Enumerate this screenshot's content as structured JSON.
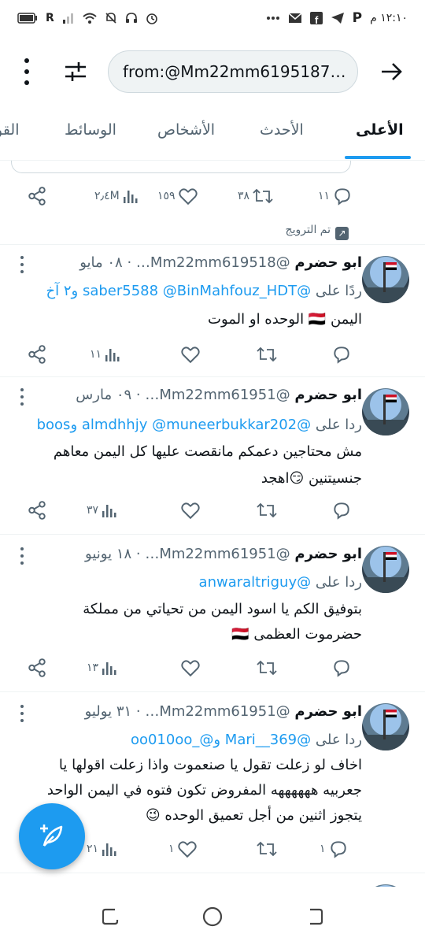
{
  "status_bar": {
    "time": "١٢:١٠ م",
    "carrier": "R",
    "icons": [
      "battery-icon",
      "signal-icon",
      "wifi-icon",
      "mute-icon",
      "headset-icon",
      "alarm-icon",
      "more-dots-icon",
      "mail-icon",
      "facebook-icon",
      "telegram-icon",
      "p-app-icon"
    ]
  },
  "search": {
    "query": "from:@Mm22mm6195187…"
  },
  "tabs": [
    {
      "label": "الأعلى",
      "active": true
    },
    {
      "label": "الأحدث",
      "active": false
    },
    {
      "label": "الأشخاص",
      "active": false
    },
    {
      "label": "الوسائط",
      "active": false
    },
    {
      "label": "القو",
      "active": false
    }
  ],
  "promoted_tweet": {
    "replies": "١١",
    "retweets": "٣٨",
    "likes": "١٥٩",
    "views": "٢٫٤M",
    "promoted_label": "تم الترويج"
  },
  "tweets": [
    {
      "name": "ابو حضرم",
      "handle": "@Mm22mm619518…",
      "date": "٠٨ مايو",
      "reply_prefix": "ردًا على",
      "reply_mentions": "@saber5588 @BinMahfouz_HDT",
      "reply_suffix": "و٢ آخ",
      "lines": [
        "اليمن 🇾🇪 الوحده او الموت"
      ],
      "replies": "",
      "retweets": "",
      "likes": "",
      "views": "١١"
    },
    {
      "name": "ابو حضرم",
      "handle": "@Mm22mm61951…",
      "date": "٠٩ مارس",
      "reply_prefix": "ردا على",
      "reply_mentions": "@almdhhjy @muneerbukkar202",
      "reply_suffix": "وboos",
      "lines": [
        "مش محتاجين دعمكم مانقصت عليها كل اليمن  معاهم",
        "جنسيتنين 😏اهجد"
      ],
      "replies": "",
      "retweets": "",
      "likes": "",
      "views": "٣٧"
    },
    {
      "name": "ابو حضرم",
      "handle": "@Mm22mm61951…",
      "date": "١٨ يونيو",
      "reply_prefix": "ردا على",
      "reply_mentions": "@anwaraltriguy",
      "reply_suffix": "",
      "lines": [
        "بتوفيق الكم يا اسود اليمن من تحياتي من مملكة",
        "حضرموت العظمى 🇾🇪"
      ],
      "replies": "",
      "retweets": "",
      "likes": "",
      "views": "١٣"
    },
    {
      "name": "ابو حضرم",
      "handle": "@Mm22mm61951…",
      "date": "٣١ يوليو",
      "reply_prefix": "ردا على",
      "reply_mentions": "@Mari__369 و@_oo010oo",
      "reply_suffix": "",
      "lines": [
        "اخاف لو زعلت تقول يا صنعموت واذا زعلت اقولها يا",
        "جعربيه ههههههه  المفروض تكون فتوه في اليمن الواحد",
        "يتجوز اثنين من أجل تعميق الوحده 😉"
      ],
      "replies": "١",
      "retweets": "",
      "likes": "١",
      "views": "٢١"
    }
  ],
  "colors": {
    "accent": "#1d9bf0",
    "text": "#0f1419",
    "secondary": "#536471"
  }
}
